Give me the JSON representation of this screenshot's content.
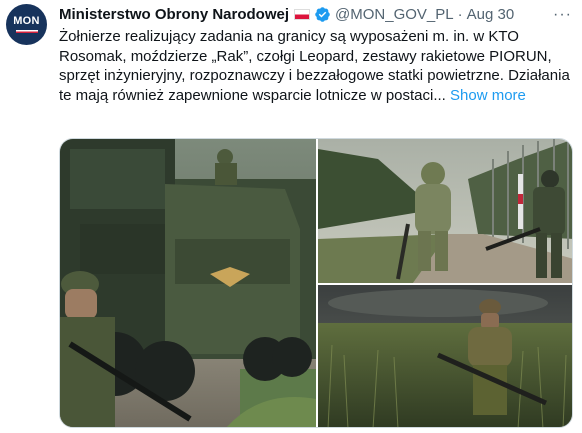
{
  "author": {
    "avatar_text": "MON",
    "name": "Ministerstwo Obrony Narodowej",
    "flag_icon": "poland-flag-icon",
    "verified_icon": "verified-badge-icon",
    "handle": "@MON_GOV_PL",
    "separator": "·",
    "date": "Aug 30"
  },
  "more_options": "···",
  "tweet": {
    "text": "Żołnierze  realizujący zadania na granicy są wyposażeni m. in. w KTO Rosomak, moździerze „Rak”, czołgi Leopard, zestawy rakietowe PIORUN, sprzęt inżynieryjny, rozpoznawczy i bezzałogowe statki powietrzne. Działania te mają również zapewnione wsparcie lotnicze w postaci...",
    "show_more": "Show more"
  },
  "media": {
    "photos": [
      {
        "name": "armored-vehicles-photo"
      },
      {
        "name": "soldiers-border-road-photo"
      },
      {
        "name": "soldier-in-field-photo"
      }
    ]
  },
  "colors": {
    "link": "#1d9bf0",
    "verified": "#1d9bf0",
    "secondary_text": "#536471",
    "avatar_bg": "#17335c"
  }
}
